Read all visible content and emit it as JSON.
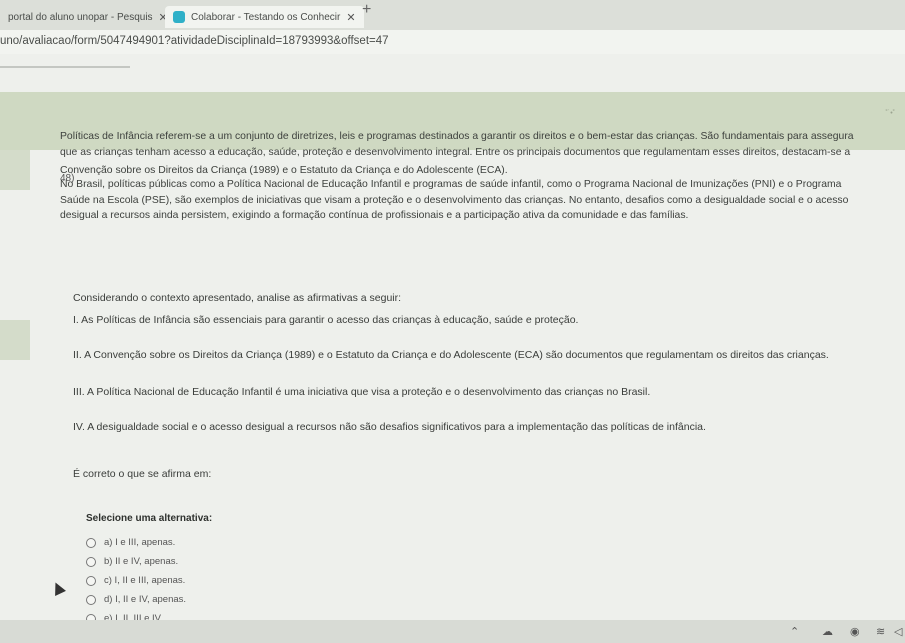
{
  "tabs": [
    {
      "title": "portal do aluno unopar - Pesquis",
      "close": "✕"
    },
    {
      "title": "Colaborar - Testando os Conhecir",
      "close": "✕"
    }
  ],
  "new_tab": "+",
  "url": "uno/avaliacao/form/5047494901?atividadeDisciplinaId=18793993&offset=47",
  "question": {
    "number": "48)",
    "paragraph": [
      "Políticas de Infância referem-se a um conjunto de diretrizes, leis e programas destinados a garantir os direitos e o bem-estar das crianças. São fundamentais para assegura",
      "que as crianças tenham acesso a educação, saúde, proteção e desenvolvimento integral. Entre os principais documentos que regulamentam esses direitos, destacam-se a",
      "Convenção sobre os Direitos da Criança (1989) e o Estatuto da Criança e do Adolescente (ECA).",
      "No Brasil, políticas públicas como a Política Nacional de Educação Infantil e programas de saúde infantil, como o Programa Nacional de Imunizações (PNI) e o Programa",
      "Saúde na Escola (PSE), são exemplos de iniciativas que visam a proteção e o desenvolvimento das crianças. No entanto, desafios como a desigualdade social e o acesso",
      "desigual a recursos ainda persistem, exigindo a formação contínua de profissionais e a participação ativa da comunidade e das famílias."
    ],
    "intro": "Considerando o contexto apresentado, analise as afirmativas a seguir:",
    "statements": [
      "I. As Políticas de Infância são essenciais para garantir o acesso das crianças à educação, saúde e proteção.",
      "II. A Convenção sobre os Direitos da Criança (1989) e o Estatuto da Criança e do Adolescente (ECA) são documentos que regulamentam os direitos das crianças.",
      "III. A Política Nacional de Educação Infantil é uma iniciativa que visa a proteção e o desenvolvimento das crianças no Brasil.",
      "IV. A desigualdade social e o acesso desigual a recursos não são desafios significativos para a implementação das políticas de infância."
    ],
    "ask": "É correto o que se afirma em:",
    "select_title": "Selecione uma alternativa:",
    "options": [
      "a) I e III, apenas.",
      "b) II e IV, apenas.",
      "c) I, II e III, apenas.",
      "d) I, II e IV, apenas.",
      "e) I, II, III e IV."
    ]
  },
  "colors": {
    "accent": "#2fb0c8",
    "header_band": "#cfd9c2"
  }
}
